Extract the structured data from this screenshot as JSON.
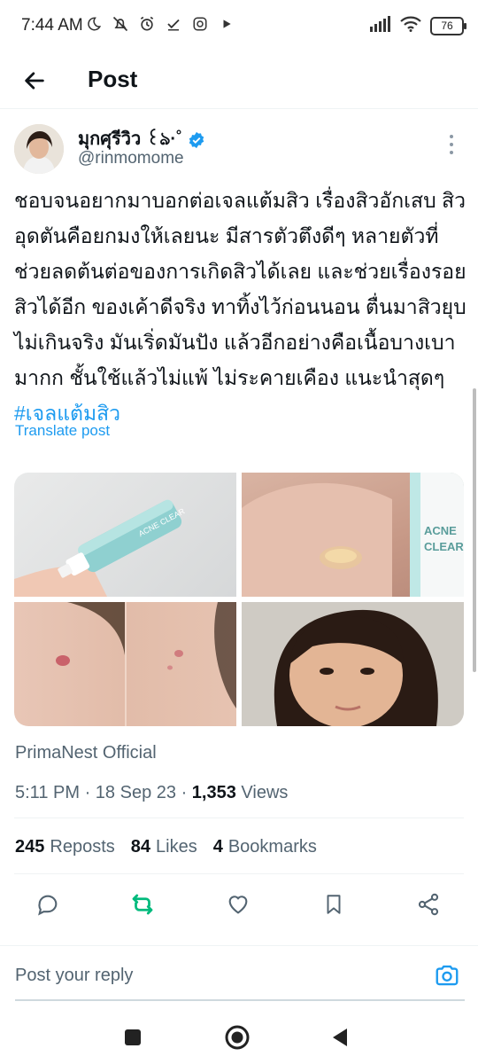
{
  "status_bar": {
    "time": "7:44 AM",
    "battery": "76",
    "icons": [
      "moon-icon",
      "mute-icon",
      "alarm-icon",
      "check-icon",
      "instagram-icon",
      "play-icon",
      "signal-icon",
      "wifi-icon",
      "battery-icon"
    ]
  },
  "header": {
    "title": "Post"
  },
  "author": {
    "name": "มุกศุรีวิว ꒰ঌ·˚",
    "handle": "@rinmomome"
  },
  "post": {
    "text": "ชอบจนอยากมาบอกต่อเจลแต้มสิว เรื่องสิวอักเสบ สิวอุดตันคือยกมงให้เลยนะ มีสารตัวตึงดีๆ หลายตัวที่ช่วยลดต้นต่อของการเกิดสิวได้เลย และช่วยเรื่องรอยสิวได้อีก ของเค้าดีจริง ทาทิ้งไว้ก่อนนอน ตื่นมาสิวยุบไม่เกินจริง มันเริ่ดมันปัง แล้วอีกอย่างคือเนื้อบางเบามากก ชั้นใช้แล้วไม่แพ้ ไม่ระคายเคือง แนะนำสุดๆ ",
    "hashtag": "#เจลแต้มสิว",
    "translate": "Translate post",
    "media_labels": {
      "tube_text": "ACNE CLEAR"
    },
    "source": "PrimaNest Official",
    "time": "5:11 PM",
    "sep": "·",
    "date": "18 Sep 23",
    "views_count": "1,353",
    "views_label": "Views"
  },
  "stats": {
    "reposts_count": "245",
    "reposts_label": "Reposts",
    "likes_count": "84",
    "likes_label": "Likes",
    "bookmarks_count": "4",
    "bookmarks_label": "Bookmarks"
  },
  "reply": {
    "placeholder": "Post your reply"
  },
  "colors": {
    "accent": "#1d9bf0",
    "repost_green": "#00ba7c",
    "text": "#0f1419",
    "muted": "#536471"
  }
}
